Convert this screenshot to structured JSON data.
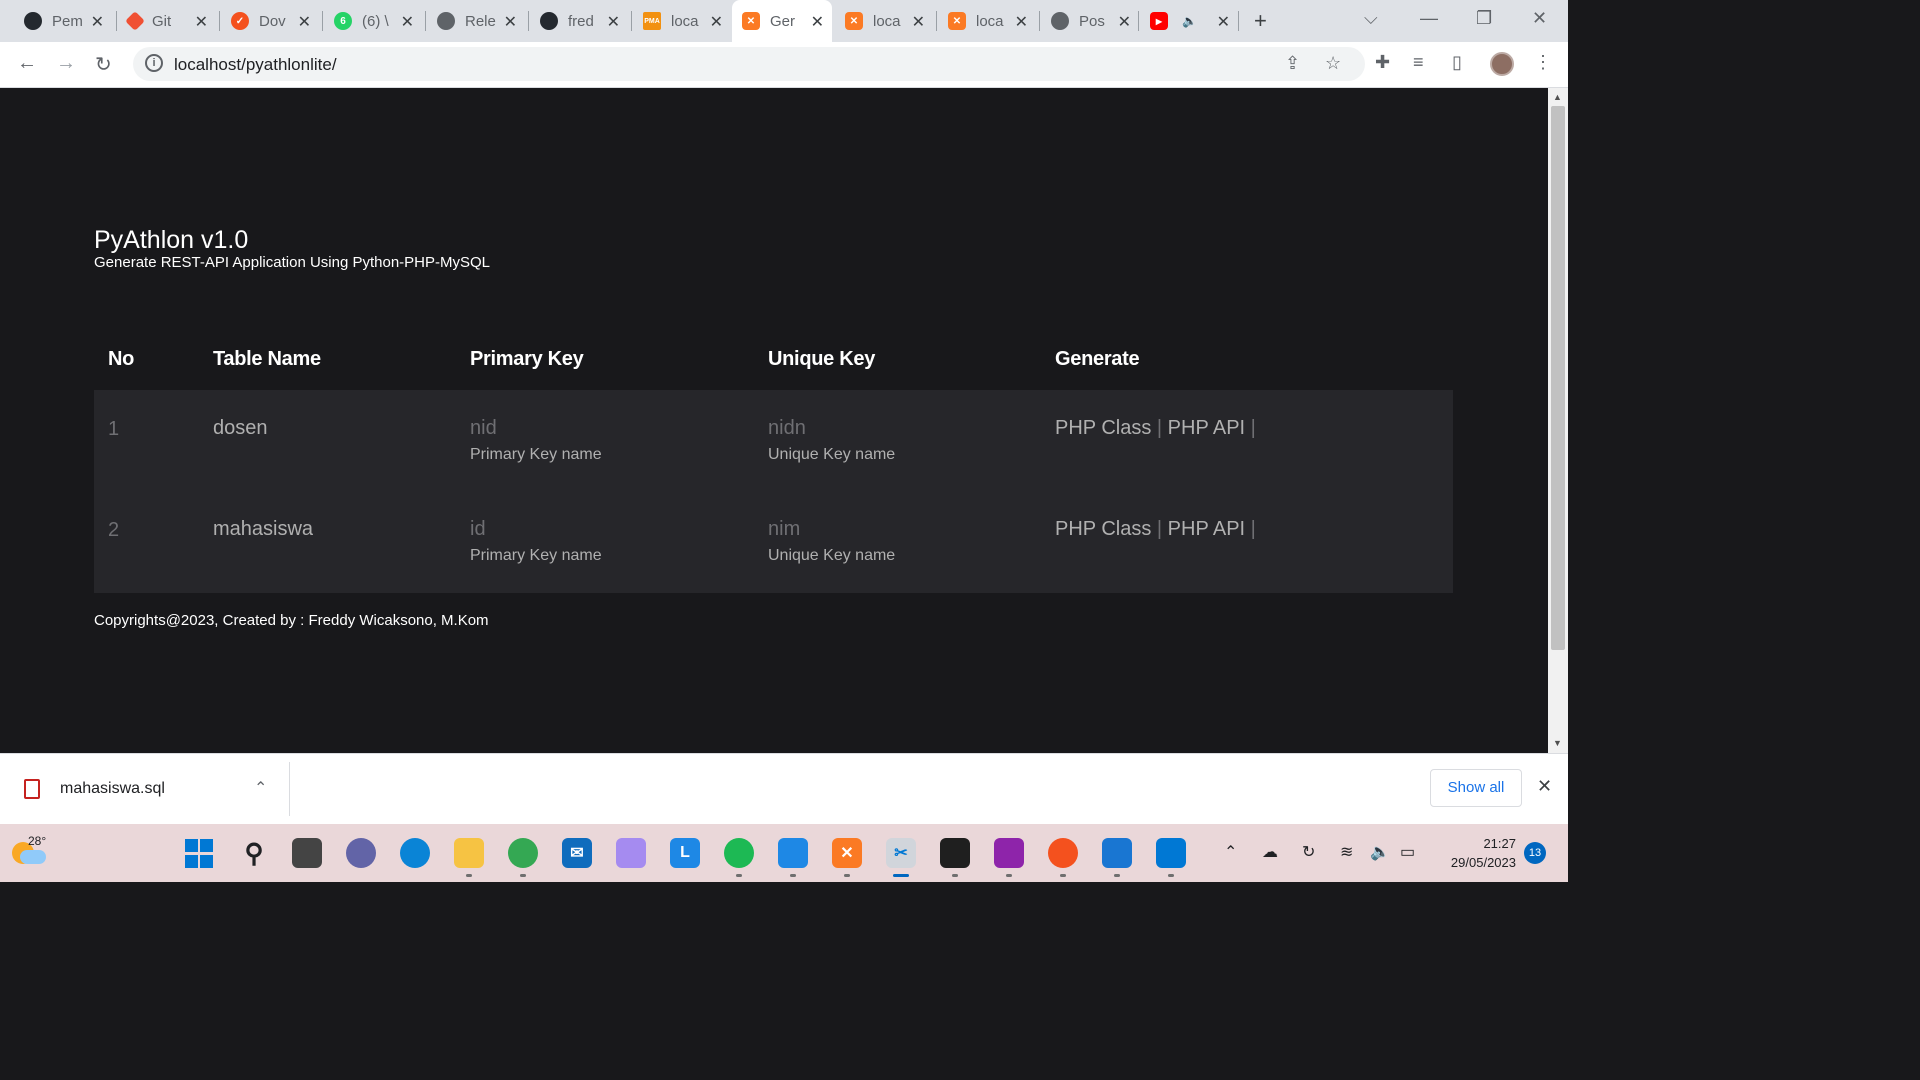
{
  "browser": {
    "tabs": [
      {
        "title": "Pem",
        "icon": "github-icon",
        "color": "#24292f"
      },
      {
        "title": "Git",
        "icon": "git-icon",
        "color": "#f05033"
      },
      {
        "title": "Dov",
        "icon": "download-site-icon",
        "color": "#f4511e"
      },
      {
        "title": "(6) \\",
        "icon": "whatsapp-icon",
        "color": "#25d366"
      },
      {
        "title": "Rele",
        "icon": "globe-icon",
        "color": "#5f6368"
      },
      {
        "title": "fred",
        "icon": "github-icon",
        "color": "#24292f"
      },
      {
        "title": "loca",
        "icon": "phpmyadmin-icon",
        "color": "#f29111"
      },
      {
        "title": "Ger",
        "icon": "xampp-icon",
        "color": "#fb7a24",
        "active": true
      },
      {
        "title": "loca",
        "icon": "xampp-icon",
        "color": "#fb7a24"
      },
      {
        "title": "loca",
        "icon": "xampp-icon",
        "color": "#fb7a24"
      },
      {
        "title": "Pos",
        "icon": "globe-icon",
        "color": "#5f6368"
      },
      {
        "title": "",
        "icon": "youtube-icon",
        "color": "#ff0000"
      }
    ],
    "url": "localhost/pyathlonlite/"
  },
  "app": {
    "title": "PyAthlon v1.0",
    "subtitle": "Generate REST-API Application Using Python-PHP-MySQL"
  },
  "table": {
    "headers": {
      "no": "No",
      "table_name": "Table Name",
      "primary_key": "Primary Key",
      "unique_key": "Unique Key",
      "generate": "Generate"
    },
    "rows": [
      {
        "no": "1",
        "table_name": "dosen",
        "primary_key": "nid",
        "primary_hint": "Primary Key name",
        "unique_key": "nidn",
        "unique_hint": "Unique Key name",
        "link_class": "PHP Class",
        "link_api": "PHP API",
        "sep": "|"
      },
      {
        "no": "2",
        "table_name": "mahasiswa",
        "primary_key": "id",
        "primary_hint": "Primary Key name",
        "unique_key": "nim",
        "unique_hint": "Unique Key name",
        "link_class": "PHP Class",
        "link_api": "PHP API",
        "sep": "|"
      }
    ]
  },
  "footer": "Copyrights@2023, Created by : Freddy Wicaksono, M.Kom",
  "download": {
    "filename": "mahasiswa.sql",
    "show_all": "Show all"
  },
  "taskbar": {
    "temperature": "28°",
    "time": "21:27",
    "date": "29/05/2023",
    "notifications": "13"
  }
}
